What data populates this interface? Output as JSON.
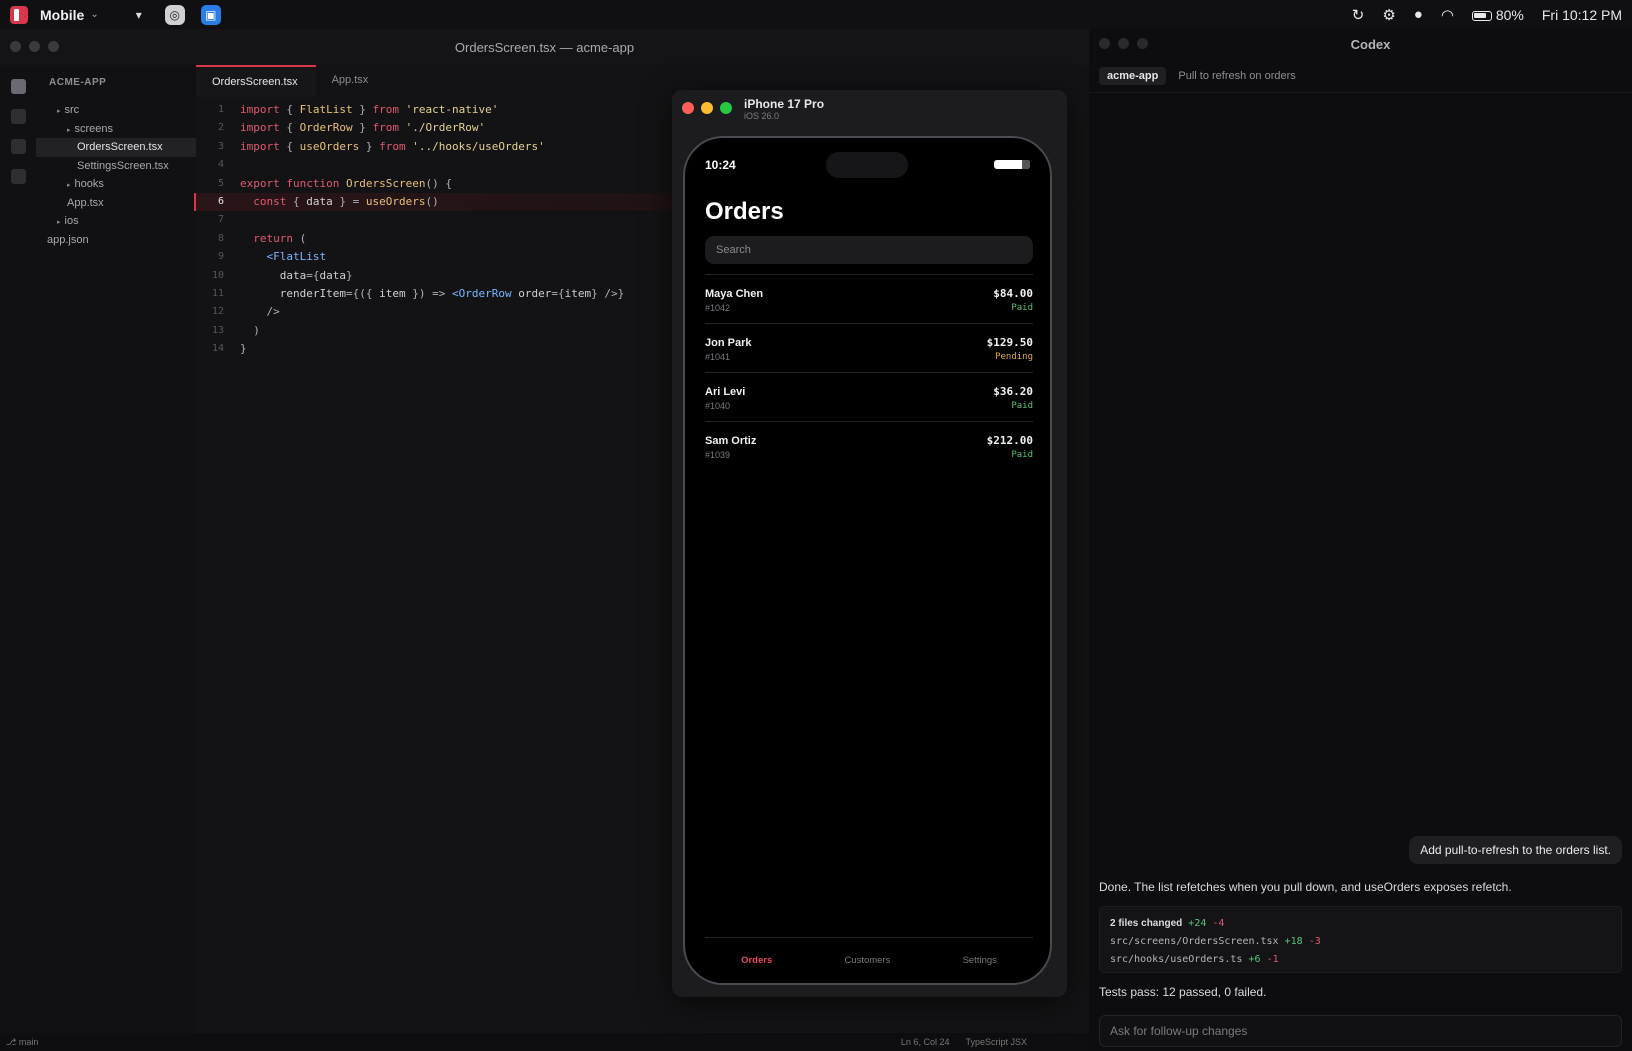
{
  "menubar": {
    "app_name": "Mobile",
    "battery": "80%",
    "clock": "Fri 10:12 PM"
  },
  "editor": {
    "window_title": "OrdersScreen.tsx — acme-app",
    "explorer_title": "ACME-APP",
    "tree": [
      {
        "label": "src",
        "indent": 1,
        "arrow": true,
        "selected": false
      },
      {
        "label": "screens",
        "indent": 2,
        "arrow": true,
        "selected": false
      },
      {
        "label": "OrdersScreen.tsx",
        "indent": 3,
        "arrow": false,
        "selected": true
      },
      {
        "label": "SettingsScreen.tsx",
        "indent": 3,
        "arrow": false,
        "selected": false
      },
      {
        "label": "hooks",
        "indent": 2,
        "arrow": true,
        "selected": false
      },
      {
        "label": "App.tsx",
        "indent": 2,
        "arrow": false,
        "selected": false
      },
      {
        "label": "ios",
        "indent": 1,
        "arrow": true,
        "selected": false
      },
      {
        "label": "app.json",
        "indent": 0,
        "arrow": false,
        "selected": false
      }
    ],
    "tabs": [
      {
        "label": "OrdersScreen.tsx",
        "active": true
      },
      {
        "label": "App.tsx",
        "active": false
      }
    ],
    "code_lines": [
      "import { FlatList } from 'react-native'",
      "import { OrderRow } from './OrderRow'",
      "import { useOrders } from '../hooks/useOrders'",
      "",
      "export function OrdersScreen() {",
      "  const { data } = useOrders()",
      "",
      "  return (",
      "    <FlatList",
      "      data={data}",
      "      renderItem={({ item }) => <OrderRow order={item} />}",
      "    />",
      "  )",
      "}"
    ],
    "current_line": 6,
    "status": {
      "branch": "main",
      "position": "Ln 6, Col 24",
      "language": "TypeScript JSX"
    }
  },
  "simulator": {
    "device": "iPhone 17 Pro",
    "os": "iOS 26.0",
    "phone_time": "10:24",
    "screen_title": "Orders",
    "search_placeholder": "Search",
    "orders": [
      {
        "name": "Maya Chen",
        "id": "#1042",
        "amount": "$84.00",
        "status": "Paid",
        "status_color": "#5cc27a"
      },
      {
        "name": "Jon Park",
        "id": "#1041",
        "amount": "$129.50",
        "status": "Pending",
        "status_color": "#e2a93b"
      },
      {
        "name": "Ari Levi",
        "id": "#1040",
        "amount": "$36.20",
        "status": "Paid",
        "status_color": "#5cc27a"
      },
      {
        "name": "Sam Ortiz",
        "id": "#1039",
        "amount": "$212.00",
        "status": "Paid",
        "status_color": "#5cc27a"
      }
    ],
    "tabbar": [
      {
        "label": "Orders",
        "active": true
      },
      {
        "label": "Customers",
        "active": false
      },
      {
        "label": "Settings",
        "active": false
      }
    ]
  },
  "codex": {
    "title": "Codex",
    "project_chip": "acme-app",
    "thread_title": "Pull to refresh on orders",
    "user_message": "Add pull-to-refresh to the orders list.",
    "reply": "Done. The list refetches when you pull down, and useOrders exposes refetch.",
    "files_summary": {
      "label": "2 files changed",
      "add": "+24",
      "del": "-4"
    },
    "files": [
      {
        "path": "src/screens/OrdersScreen.tsx",
        "add": "+18",
        "del": "-3"
      },
      {
        "path": "src/hooks/useOrders.ts",
        "add": "+6",
        "del": "-1"
      }
    ],
    "tests": "Tests pass: 12 passed, 0 failed.",
    "input_placeholder": "Ask for follow-up changes"
  },
  "colors": {
    "accent": "#d8364b",
    "paid": "#5cc27a",
    "pending": "#e2a93b"
  }
}
